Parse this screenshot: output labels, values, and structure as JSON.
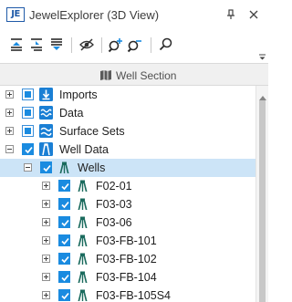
{
  "window": {
    "app_icon_text": "JE",
    "title": "JewelExplorer (3D View)"
  },
  "section": {
    "label": "Well Section"
  },
  "colors": {
    "accent": "#1a8be0",
    "selection": "#cce4f7",
    "well_icon": "#1b6b5e"
  },
  "tree": {
    "items": [
      {
        "label": "Imports",
        "icon": "import-icon",
        "check": "partial",
        "expander": "plus"
      },
      {
        "label": "Data",
        "icon": "data-wave-icon",
        "check": "partial",
        "expander": "plus"
      },
      {
        "label": "Surface Sets",
        "icon": "surface-icon",
        "check": "partial",
        "expander": "plus"
      },
      {
        "label": "Well Data",
        "icon": "well-data-icon",
        "check": "checked",
        "expander": "minus"
      },
      {
        "label": "Wells",
        "icon": "well-icon",
        "check": "checked",
        "expander": "minus",
        "selected": true
      },
      {
        "label": "F02-01",
        "icon": "well-icon",
        "check": "checked",
        "expander": "plus"
      },
      {
        "label": "F03-03",
        "icon": "well-icon",
        "check": "checked",
        "expander": "plus"
      },
      {
        "label": "F03-06",
        "icon": "well-icon",
        "check": "checked",
        "expander": "plus"
      },
      {
        "label": "F03-FB-101",
        "icon": "well-icon",
        "check": "checked",
        "expander": "plus"
      },
      {
        "label": "F03-FB-102",
        "icon": "well-icon",
        "check": "checked",
        "expander": "plus"
      },
      {
        "label": "F03-FB-104",
        "icon": "well-icon",
        "check": "checked",
        "expander": "plus"
      },
      {
        "label": "F03-FB-105S4",
        "icon": "well-icon",
        "check": "checked",
        "expander": "plus"
      }
    ]
  }
}
